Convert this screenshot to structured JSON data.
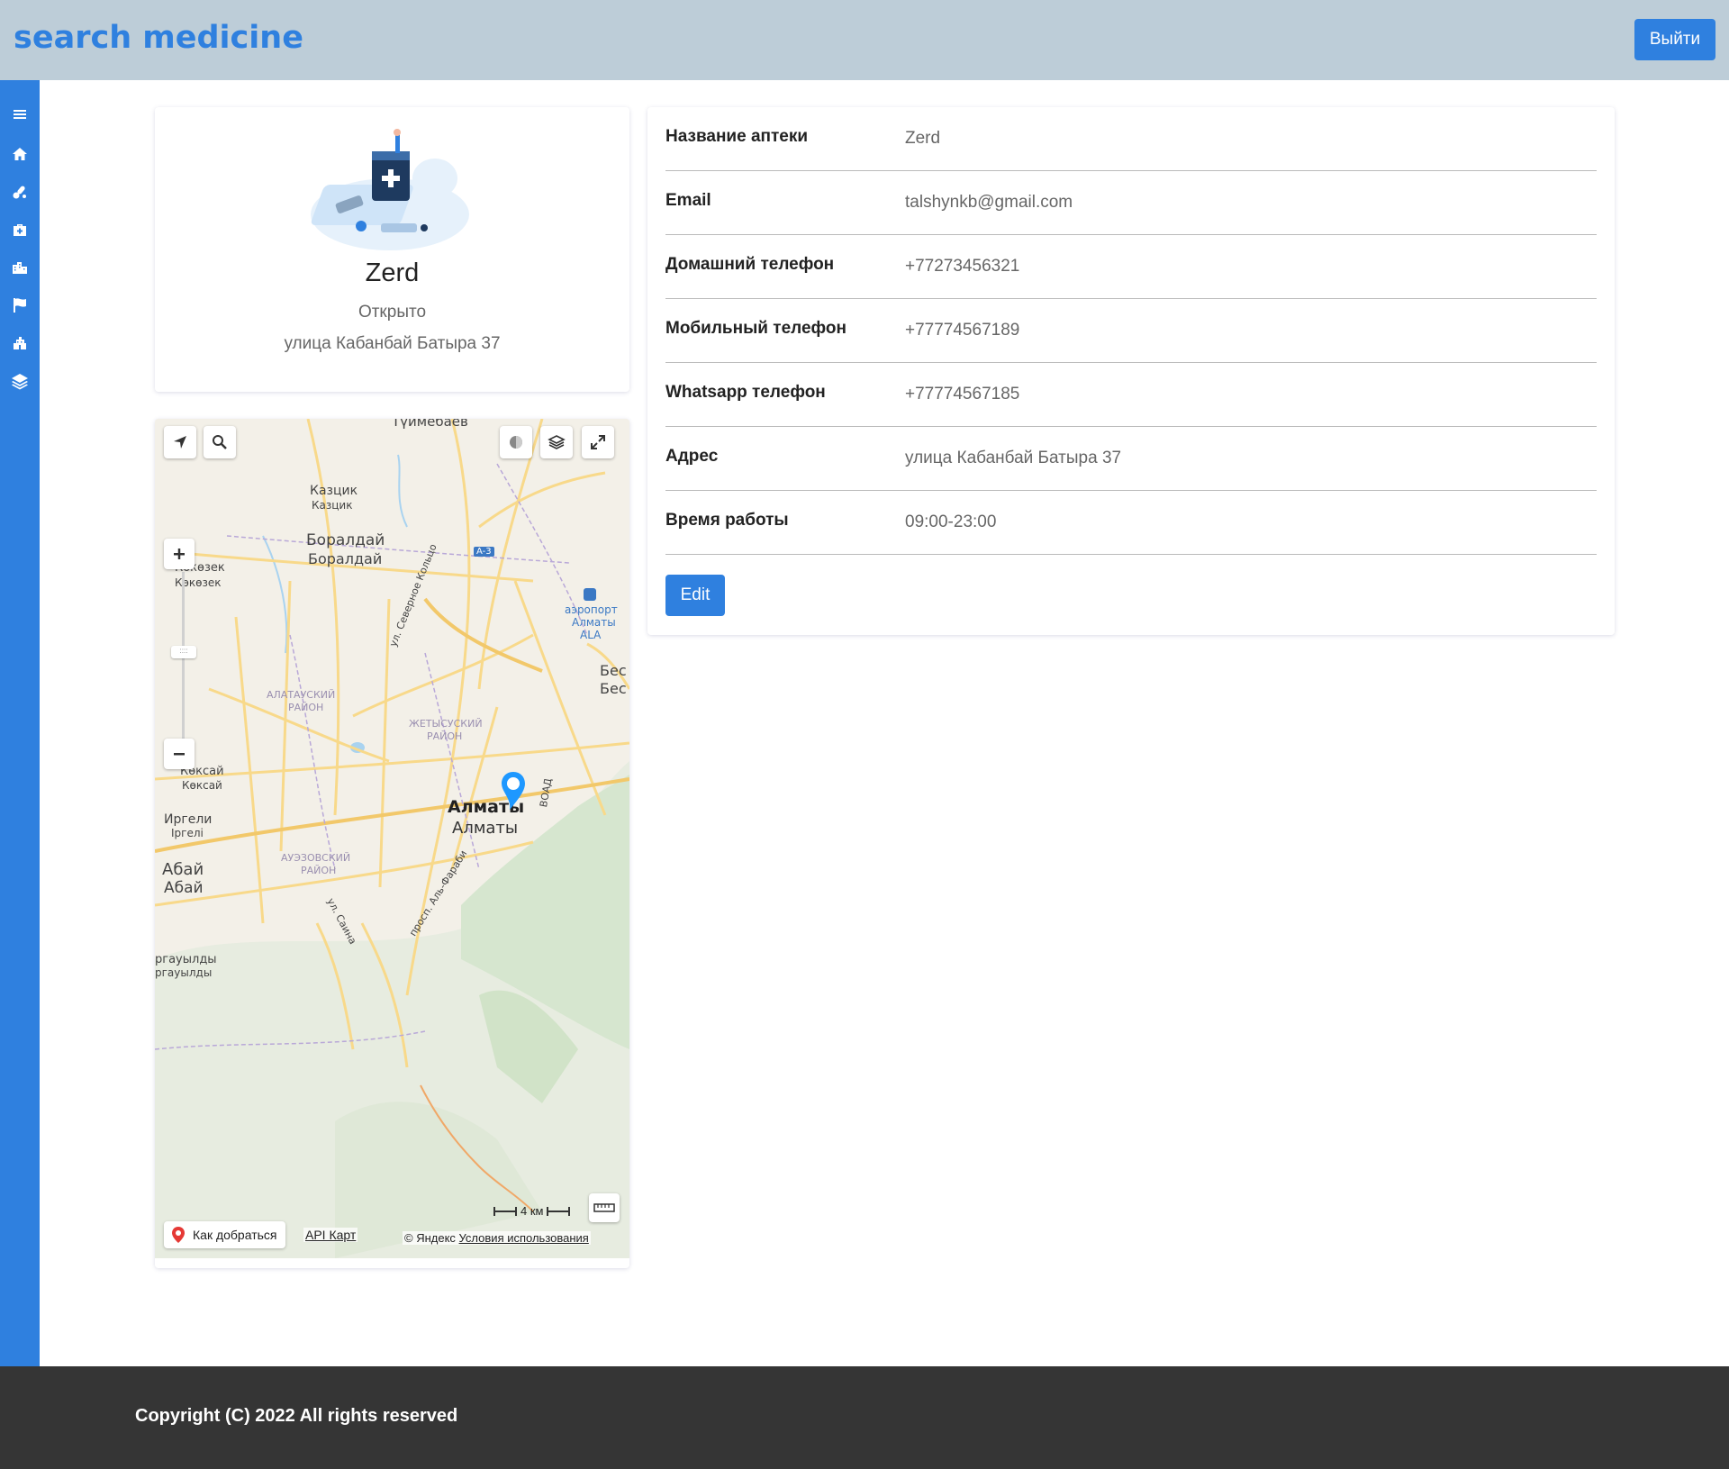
{
  "header": {
    "brand": "search medicine",
    "logout_label": "Выйти"
  },
  "sidebar": {
    "items": [
      {
        "icon": "menu-icon"
      },
      {
        "icon": "home-icon"
      },
      {
        "icon": "pills-icon"
      },
      {
        "icon": "first-aid-kit-icon"
      },
      {
        "icon": "city-icon"
      },
      {
        "icon": "flag-icon"
      },
      {
        "icon": "building-icon"
      },
      {
        "icon": "layers-icon"
      }
    ]
  },
  "profile": {
    "name": "Zerd",
    "status": "Открыто",
    "address": "улица Кабанбай Батыра 37"
  },
  "map": {
    "labels": {
      "tuimebaev": "Түймебаев",
      "kazcik1": "Казцик",
      "kazcik2": "Казцик",
      "boraldai1": "Боралдай",
      "boraldai2": "Боралдай",
      "kokozek1": "Көкөзек",
      "kokozek2": "Көкөзек",
      "a3": "A-3",
      "airport1": "аэропорт",
      "airport2": "Алматы",
      "airport3": "ALA",
      "bes1": "Бес",
      "bes2": "Бес",
      "ring": "ул. Северное Кольцо",
      "alatau1": "АЛАТАУСКИЙ",
      "alatau2": "РАЙОН",
      "zhetysu1": "ЖЕТЫСУСКИЙ",
      "zhetysu2": "РАЙОН",
      "koksai1": "Көксай",
      "koksai2": "Көксай",
      "irgeli1": "Иргели",
      "irgeli2": "Іргелі",
      "almaty1": "Алматы",
      "almaty2": "Алматы",
      "voad": "ВОАД",
      "auezov1": "АУЭЗОВСКИЙ",
      "auezov2": "РАЙОН",
      "abai1": "Абай",
      "abai2": "Абай",
      "farabi": "просп. Аль-Фараби",
      "saina": "ул. Саина",
      "ergauyldy1": "ргауылды",
      "ergauyldy2": "ргауылды"
    },
    "route_label": "Как добраться",
    "api_label": "API Карт",
    "copyright_prefix": "© Яндекс",
    "terms_label": "Условия использования",
    "scale_label": "4 км"
  },
  "details": {
    "rows": [
      {
        "label": "Название аптеки",
        "value": "Zerd"
      },
      {
        "label": "Email",
        "value": "talshynkb@gmail.com"
      },
      {
        "label": "Домашний телефон",
        "value": "+77273456321"
      },
      {
        "label": "Мобильный телефон",
        "value": "+77774567189"
      },
      {
        "label": "Whatsapp телефон",
        "value": "+77774567185"
      },
      {
        "label": "Адрес",
        "value": "улица Кабанбай Батыра 37"
      },
      {
        "label": "Время работы",
        "value": "09:00-23:00"
      }
    ],
    "edit_label": "Edit"
  },
  "footer": {
    "text": "Copyright (C) 2022 All rights reserved"
  },
  "colors": {
    "accent": "#2f80df",
    "header_bg": "#bdcdd8",
    "footer_bg": "#353535"
  }
}
